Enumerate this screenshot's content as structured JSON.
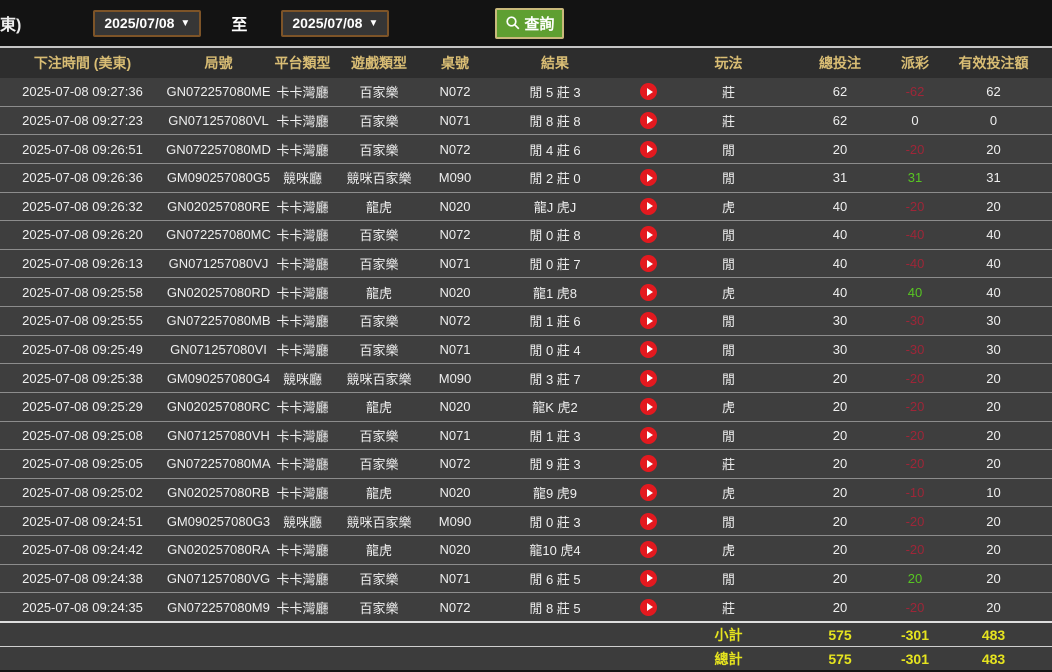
{
  "toolbar": {
    "partial_left_text": "東)",
    "date_from": "2025/07/08",
    "to_label": "至",
    "date_to": "2025/07/08",
    "search_label": "查詢",
    "dropdown_arrow": "▼"
  },
  "table": {
    "headers": [
      "下注時間 (美東)",
      "局號",
      "平台類型",
      "遊戲類型",
      "桌號",
      "結果",
      "",
      "玩法",
      "總投注",
      "派彩",
      "有效投注額"
    ],
    "rows": [
      {
        "time": "2025-07-08 09:27:36",
        "round": "GN072257080ME",
        "platform": "卡卡灣廳",
        "game": "百家樂",
        "table_no": "N072",
        "result": "閒 5 莊 3",
        "play_type": "莊",
        "total_bet": "62",
        "payout": "-62",
        "valid_bet": "62"
      },
      {
        "time": "2025-07-08 09:27:23",
        "round": "GN071257080VL",
        "platform": "卡卡灣廳",
        "game": "百家樂",
        "table_no": "N071",
        "result": "閒 8 莊 8",
        "play_type": "莊",
        "total_bet": "62",
        "payout": "0",
        "valid_bet": "0"
      },
      {
        "time": "2025-07-08 09:26:51",
        "round": "GN072257080MD",
        "platform": "卡卡灣廳",
        "game": "百家樂",
        "table_no": "N072",
        "result": "閒 4 莊 6",
        "play_type": "閒",
        "total_bet": "20",
        "payout": "-20",
        "valid_bet": "20"
      },
      {
        "time": "2025-07-08 09:26:36",
        "round": "GM090257080G5",
        "platform": "競咪廳",
        "game": "競咪百家樂",
        "table_no": "M090",
        "result": "閒 2 莊 0",
        "play_type": "閒",
        "total_bet": "31",
        "payout": "31",
        "valid_bet": "31"
      },
      {
        "time": "2025-07-08 09:26:32",
        "round": "GN020257080RE",
        "platform": "卡卡灣廳",
        "game": "龍虎",
        "table_no": "N020",
        "result": "龍J 虎J",
        "play_type": "虎",
        "total_bet": "40",
        "payout": "-20",
        "valid_bet": "20"
      },
      {
        "time": "2025-07-08 09:26:20",
        "round": "GN072257080MC",
        "platform": "卡卡灣廳",
        "game": "百家樂",
        "table_no": "N072",
        "result": "閒 0 莊 8",
        "play_type": "閒",
        "total_bet": "40",
        "payout": "-40",
        "valid_bet": "40"
      },
      {
        "time": "2025-07-08 09:26:13",
        "round": "GN071257080VJ",
        "platform": "卡卡灣廳",
        "game": "百家樂",
        "table_no": "N071",
        "result": "閒 0 莊 7",
        "play_type": "閒",
        "total_bet": "40",
        "payout": "-40",
        "valid_bet": "40"
      },
      {
        "time": "2025-07-08 09:25:58",
        "round": "GN020257080RD",
        "platform": "卡卡灣廳",
        "game": "龍虎",
        "table_no": "N020",
        "result": "龍1 虎8",
        "play_type": "虎",
        "total_bet": "40",
        "payout": "40",
        "valid_bet": "40"
      },
      {
        "time": "2025-07-08 09:25:55",
        "round": "GN072257080MB",
        "platform": "卡卡灣廳",
        "game": "百家樂",
        "table_no": "N072",
        "result": "閒 1 莊 6",
        "play_type": "閒",
        "total_bet": "30",
        "payout": "-30",
        "valid_bet": "30"
      },
      {
        "time": "2025-07-08 09:25:49",
        "round": "GN071257080VI",
        "platform": "卡卡灣廳",
        "game": "百家樂",
        "table_no": "N071",
        "result": "閒 0 莊 4",
        "play_type": "閒",
        "total_bet": "30",
        "payout": "-30",
        "valid_bet": "30"
      },
      {
        "time": "2025-07-08 09:25:38",
        "round": "GM090257080G4",
        "platform": "競咪廳",
        "game": "競咪百家樂",
        "table_no": "M090",
        "result": "閒 3 莊 7",
        "play_type": "閒",
        "total_bet": "20",
        "payout": "-20",
        "valid_bet": "20"
      },
      {
        "time": "2025-07-08 09:25:29",
        "round": "GN020257080RC",
        "platform": "卡卡灣廳",
        "game": "龍虎",
        "table_no": "N020",
        "result": "龍K 虎2",
        "play_type": "虎",
        "total_bet": "20",
        "payout": "-20",
        "valid_bet": "20"
      },
      {
        "time": "2025-07-08 09:25:08",
        "round": "GN071257080VH",
        "platform": "卡卡灣廳",
        "game": "百家樂",
        "table_no": "N071",
        "result": "閒 1 莊 3",
        "play_type": "閒",
        "total_bet": "20",
        "payout": "-20",
        "valid_bet": "20"
      },
      {
        "time": "2025-07-08 09:25:05",
        "round": "GN072257080MA",
        "platform": "卡卡灣廳",
        "game": "百家樂",
        "table_no": "N072",
        "result": "閒 9 莊 3",
        "play_type": "莊",
        "total_bet": "20",
        "payout": "-20",
        "valid_bet": "20"
      },
      {
        "time": "2025-07-08 09:25:02",
        "round": "GN020257080RB",
        "platform": "卡卡灣廳",
        "game": "龍虎",
        "table_no": "N020",
        "result": "龍9 虎9",
        "play_type": "虎",
        "total_bet": "20",
        "payout": "-10",
        "valid_bet": "10"
      },
      {
        "time": "2025-07-08 09:24:51",
        "round": "GM090257080G3",
        "platform": "競咪廳",
        "game": "競咪百家樂",
        "table_no": "M090",
        "result": "閒 0 莊 3",
        "play_type": "閒",
        "total_bet": "20",
        "payout": "-20",
        "valid_bet": "20"
      },
      {
        "time": "2025-07-08 09:24:42",
        "round": "GN020257080RA",
        "platform": "卡卡灣廳",
        "game": "龍虎",
        "table_no": "N020",
        "result": "龍10 虎4",
        "play_type": "虎",
        "total_bet": "20",
        "payout": "-20",
        "valid_bet": "20"
      },
      {
        "time": "2025-07-08 09:24:38",
        "round": "GN071257080VG",
        "platform": "卡卡灣廳",
        "game": "百家樂",
        "table_no": "N071",
        "result": "閒 6 莊 5",
        "play_type": "閒",
        "total_bet": "20",
        "payout": "20",
        "valid_bet": "20"
      },
      {
        "time": "2025-07-08 09:24:35",
        "round": "GN072257080M9",
        "platform": "卡卡灣廳",
        "game": "百家樂",
        "table_no": "N072",
        "result": "閒 8 莊 5",
        "play_type": "莊",
        "total_bet": "20",
        "payout": "-20",
        "valid_bet": "20"
      }
    ],
    "subtotal": {
      "label": "小計",
      "total_bet": "575",
      "payout": "-301",
      "valid_bet": "483"
    },
    "grand_total": {
      "label": "總計",
      "total_bet": "575",
      "payout": "-301",
      "valid_bet": "483"
    }
  },
  "colors": {
    "win_green": "#57c522",
    "loss_red": "#9e2638",
    "footer_yellow": "#e6e41f",
    "header_gold": "#d9bd74",
    "search_button_green": "#5f9f31",
    "play_icon_red": "#e3191f",
    "date_border_brown": "#7d5428"
  }
}
